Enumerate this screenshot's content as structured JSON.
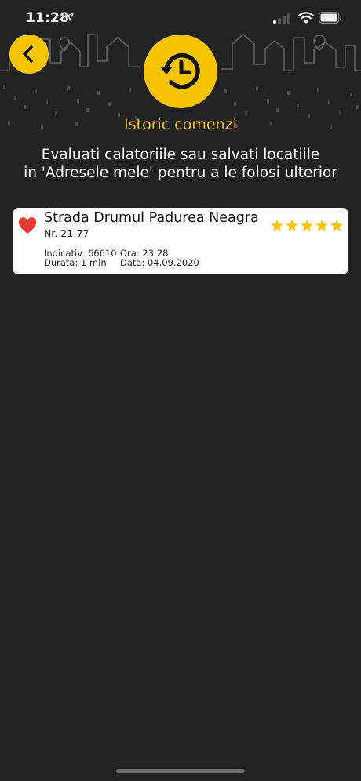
{
  "status_bar": {
    "time": "11:28"
  },
  "header": {
    "back_icon": "chevron-left-icon",
    "history_icon": "history-clock-icon",
    "title": "Istoric comenzi"
  },
  "subtitle": {
    "line1": "Evaluati calatoriile sau salvati locatiile",
    "line2": "in 'Adresele mele' pentru a le folosi ulterior"
  },
  "trips": [
    {
      "street": "Strada Drumul Padurea Neagra",
      "number": "Nr. 21-77",
      "indicativ": "Indicativ: 66610",
      "ora": "Ora: 23:28",
      "durata": "Durata: 1 min",
      "data": "Data: 04.09.2020",
      "favorite": true,
      "rating": 5,
      "max_rating": 5
    }
  ],
  "colors": {
    "background": "#222222",
    "accent": "#f6c400",
    "favorite": "#e53935",
    "card": "#ffffff"
  }
}
